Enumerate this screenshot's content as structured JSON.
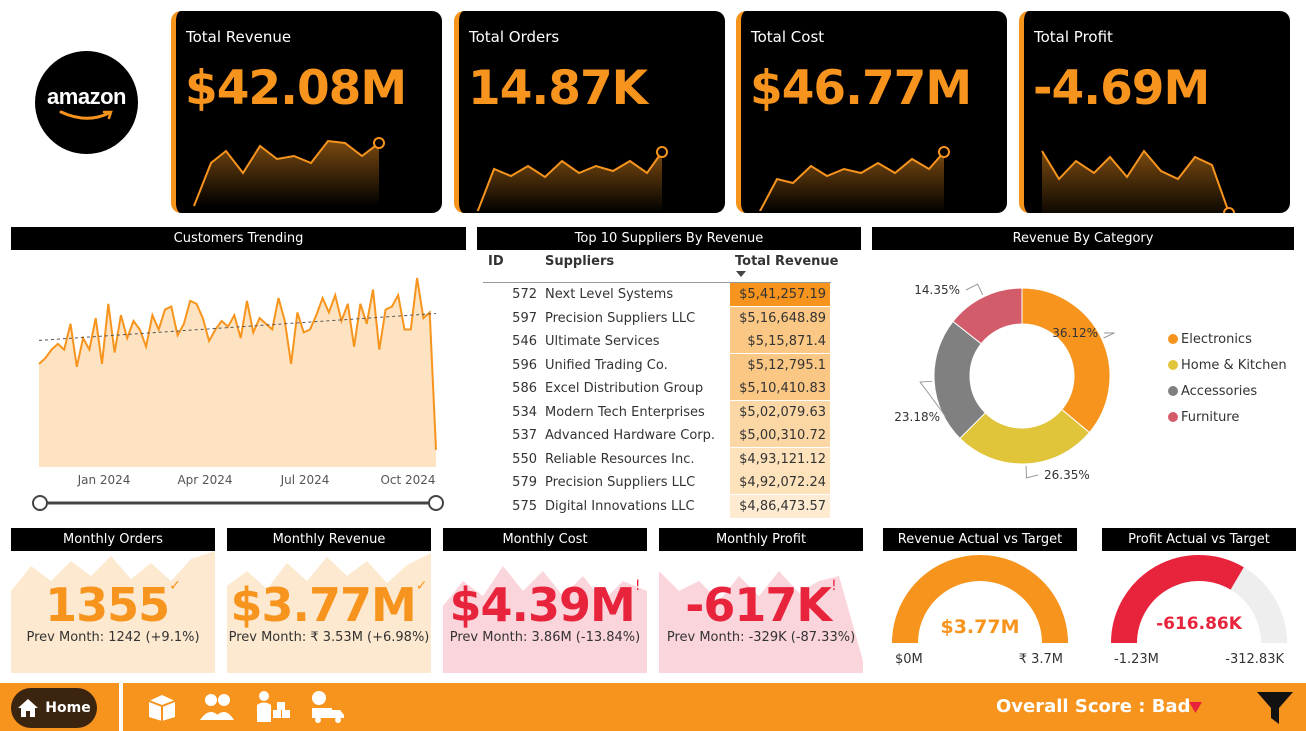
{
  "logo": {
    "text": "amazon"
  },
  "kpis": [
    {
      "title": "Total Revenue",
      "value": "$42.08M"
    },
    {
      "title": "Total Orders",
      "value": "14.87K"
    },
    {
      "title": "Total Cost",
      "value": "$46.77M"
    },
    {
      "title": "Total Profit",
      "value": "-4.69M"
    }
  ],
  "customers": {
    "title": "Customers Trending",
    "x_ticks": [
      "Jan 2024",
      "Apr 2024",
      "Jul 2024",
      "Oct 2024"
    ]
  },
  "suppliers": {
    "title": "Top 10 Suppliers By Revenue",
    "columns": [
      "ID",
      "Suppliers",
      "Total Revenue"
    ],
    "rows": [
      {
        "id": "572",
        "name": "Next Level Systems",
        "revenue": "$5,41,257.19"
      },
      {
        "id": "597",
        "name": "Precision Suppliers LLC",
        "revenue": "$5,16,648.89"
      },
      {
        "id": "546",
        "name": "Ultimate Services",
        "revenue": "$5,15,871.4"
      },
      {
        "id": "596",
        "name": "Unified Trading Co.",
        "revenue": "$5,12,795.1"
      },
      {
        "id": "586",
        "name": "Excel Distribution Group",
        "revenue": "$5,10,410.83"
      },
      {
        "id": "534",
        "name": "Modern Tech Enterprises",
        "revenue": "$5,02,079.63"
      },
      {
        "id": "537",
        "name": "Advanced Hardware Corp.",
        "revenue": "$5,00,310.72"
      },
      {
        "id": "550",
        "name": "Reliable Resources Inc.",
        "revenue": "$4,93,121.12"
      },
      {
        "id": "579",
        "name": "Precision Suppliers LLC",
        "revenue": "$4,92,072.24"
      },
      {
        "id": "575",
        "name": "Digital Innovations LLC",
        "revenue": "$4,86,473.57"
      }
    ]
  },
  "category": {
    "title": "Revenue By Category",
    "slices": [
      {
        "name": "Electronics",
        "pct": 36.12,
        "label": "36.12%",
        "color": "#f7941d"
      },
      {
        "name": "Home & Kitchen",
        "pct": 26.35,
        "label": "26.35%",
        "color": "#e0c43a"
      },
      {
        "name": "Accessories",
        "pct": 23.18,
        "label": "23.18%",
        "color": "#808080"
      },
      {
        "name": "Furniture",
        "pct": 14.35,
        "label": "14.35%",
        "color": "#d35c6a"
      }
    ]
  },
  "monthly": [
    {
      "title": "Monthly Orders",
      "value": "1355",
      "mark": "✓",
      "sub": "Prev Month: 1242 (+9.1%)"
    },
    {
      "title": "Monthly Revenue",
      "value": "$3.77M",
      "mark": "✓",
      "sub": "Prev Month: ₹ 3.53M (+6.98%)"
    },
    {
      "title": "Monthly Cost",
      "value": "$4.39M",
      "mark": "!",
      "sub": "Prev Month: 3.86M (-13.84%)"
    },
    {
      "title": "Monthly Profit",
      "value": "-617K",
      "mark": "!",
      "sub": "Prev Month: -329K (-87.33%)"
    }
  ],
  "gauges": [
    {
      "title": "Revenue Actual vs Target",
      "value": "$3.77M",
      "min": "$0M",
      "max": "₹ 3.7M",
      "fill": 1.0,
      "color": "#f7941d"
    },
    {
      "title": "Profit Actual vs Target",
      "value": "-616.86K",
      "min": "-1.23M",
      "max": "-312.83K",
      "fill": 0.67,
      "color": "#e8243c"
    }
  ],
  "nav": {
    "home_label": "Home",
    "score_label": "Overall Score : Bad"
  },
  "colors": {
    "accent": "#f7941d",
    "negative": "#e8243c",
    "positive": "#f7941d"
  },
  "chart_data": [
    {
      "type": "line",
      "title": "Customers Trending",
      "x": [
        "Jan 2024",
        "Apr 2024",
        "Jul 2024",
        "Oct 2024"
      ],
      "series": [
        {
          "values": [
            180,
            190,
            205,
            215,
            205,
            250,
            175,
            225,
            205,
            260,
            180,
            285,
            200,
            265,
            225,
            255,
            240,
            210,
            265,
            240,
            275,
            280,
            230,
            250,
            290,
            285,
            260,
            220,
            240,
            255,
            245,
            265,
            225,
            290,
            235,
            260,
            250,
            240,
            295,
            255,
            180,
            270,
            235,
            240,
            265,
            295,
            270,
            300,
            255,
            285,
            210,
            285,
            250,
            310,
            205,
            275,
            280,
            300,
            240,
            240,
            330,
            260,
            270,
            30
          ]
        }
      ],
      "trend": [
        221,
        268
      ]
    }
  ]
}
